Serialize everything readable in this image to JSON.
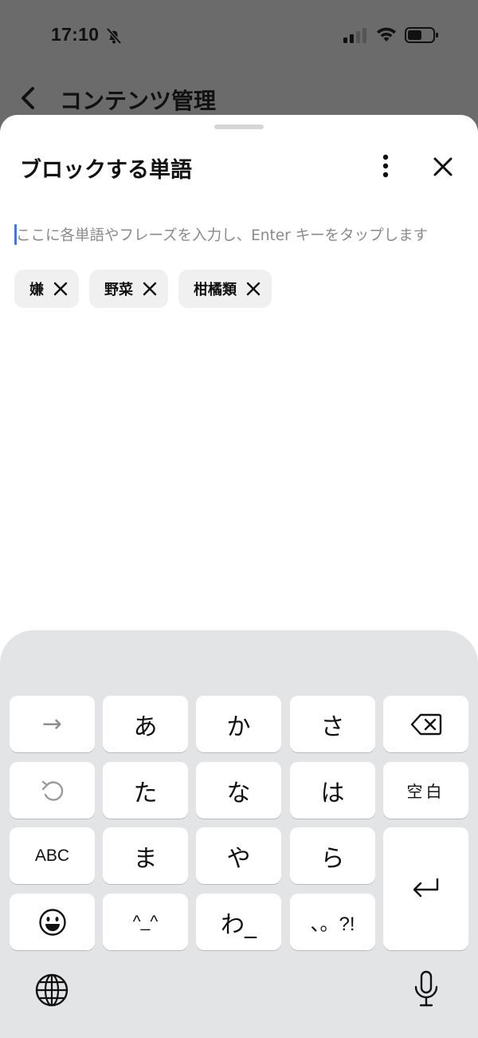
{
  "status_bar": {
    "time": "17:10",
    "icons": [
      "bell-slash-icon",
      "cellular-signal-icon",
      "wifi-icon",
      "battery-icon"
    ]
  },
  "background_page": {
    "title": "コンテンツ管理",
    "back_icon": "chevron-left-icon"
  },
  "sheet": {
    "title": "ブロックする単語",
    "more_icon": "vertical-ellipsis-icon",
    "close_icon": "close-icon",
    "input": {
      "value": "",
      "placeholder": "ここに各単語やフレーズを入力し、Enter キーをタップします"
    },
    "chips": [
      {
        "label": "嫌"
      },
      {
        "label": "野菜"
      },
      {
        "label": "柑橘類"
      }
    ]
  },
  "keyboard": {
    "keys": {
      "next": "→",
      "a": "あ",
      "ka": "か",
      "sa": "さ",
      "ta": "た",
      "na": "な",
      "ha": "は",
      "space": "空白",
      "abc": "ABC",
      "ma": "ま",
      "ya": "や",
      "ra": "ら",
      "kaomoji": "^_^",
      "wa": "わ_",
      "punct": "、。?!"
    },
    "icons": [
      "delete-icon",
      "undo-icon",
      "return-icon",
      "emoji-icon",
      "globe-icon",
      "microphone-icon"
    ]
  },
  "colors": {
    "dim_overlay": "#6b6b6b",
    "sheet": "#ffffff",
    "chip": "#f0f0f0",
    "keyboard": "#e3e4e6",
    "caret": "#4a73d9"
  }
}
